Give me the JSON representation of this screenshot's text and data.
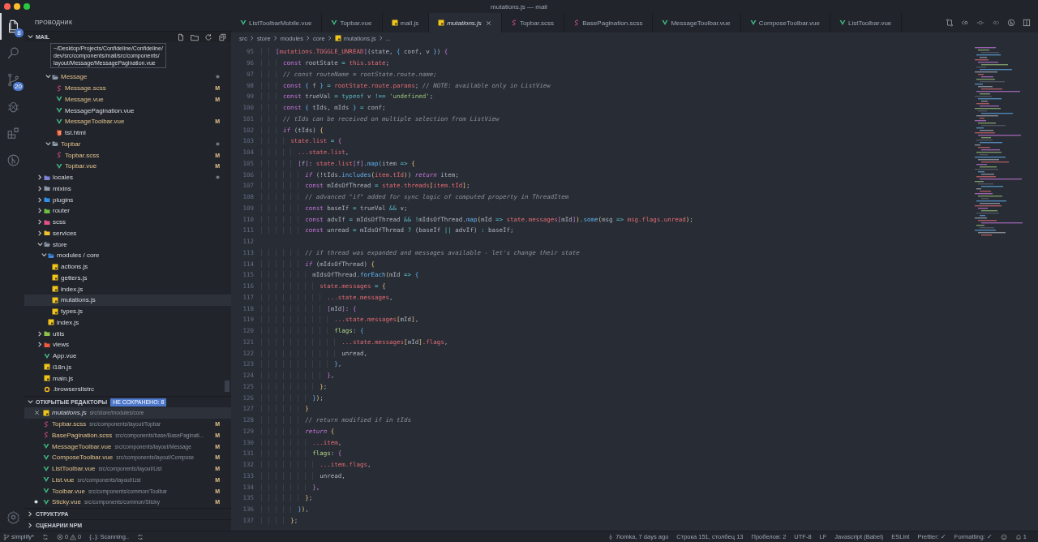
{
  "window": {
    "title": "mutations.js — mail"
  },
  "activity_bar": {
    "items": [
      {
        "kind": "files",
        "badge": "8",
        "selected": true
      },
      {
        "kind": "search",
        "selected": false
      },
      {
        "kind": "scm",
        "badge": "20",
        "selected": false
      },
      {
        "kind": "debug",
        "selected": false
      },
      {
        "kind": "extensions",
        "selected": false
      },
      {
        "kind": "gitlens",
        "selected": false
      }
    ],
    "bottom": [
      {
        "kind": "settings"
      }
    ]
  },
  "sidebar": {
    "title": "ПРОВОДНИК",
    "section": {
      "label": "MAIL",
      "expanded": true,
      "actions": [
        {
          "kind": "newfile"
        },
        {
          "kind": "newfolder"
        },
        {
          "kind": "refresh"
        },
        {
          "kind": "collapse"
        }
      ]
    },
    "tooltip": [
      "~/Desktop/Projects/Confideline/Confideline/",
      "dev/src/components/mail/src/components/",
      "layout/Message/MessagePagination.vue"
    ],
    "tree": [
      {
        "children": [
          {
            "children": [
              {
                "label": "Message",
                "kind": "folder",
                "color": "#8d99ab",
                "expanded": true,
                "dot": true,
                "modified": true,
                "selected": false,
                "children": [
                  {
                    "label": "Message.scss",
                    "kind": "scss",
                    "badge": "M",
                    "modified": true,
                    "selected": false
                  },
                  {
                    "label": "Message.vue",
                    "kind": "vue",
                    "badge": "M",
                    "modified": true,
                    "selected": false
                  },
                  {
                    "label": "MessagePagination.vue",
                    "kind": "vue",
                    "modified": false,
                    "selected": false
                  },
                  {
                    "label": "MessageToolbar.vue",
                    "kind": "vue",
                    "badge": "M",
                    "modified": true,
                    "selected": false
                  },
                  {
                    "label": "tst.html",
                    "kind": "html",
                    "modified": false,
                    "selected": false
                  }
                ]
              },
              {
                "label": "Topbar",
                "kind": "folder",
                "color": "#8d99ab",
                "expanded": true,
                "dot": true,
                "modified": true,
                "selected": false,
                "children": [
                  {
                    "label": "Topbar.scss",
                    "kind": "scss",
                    "badge": "M",
                    "modified": true,
                    "selected": false
                  },
                  {
                    "label": "Topbar.vue",
                    "kind": "vue",
                    "badge": "M",
                    "modified": true,
                    "selected": false
                  }
                ]
              }
            ]
          }
        ]
      },
      {
        "label": "locales",
        "kind": "folder",
        "color": "#7e83d8",
        "expanded": false,
        "dot": true,
        "modified": false,
        "selected": false
      },
      {
        "label": "mixins",
        "kind": "folder",
        "color": "#8d99ab",
        "expanded": false,
        "dot": false,
        "modified": false,
        "selected": false
      },
      {
        "label": "plugins",
        "kind": "folder",
        "color": "#2f8fea",
        "expanded": false,
        "dot": false,
        "modified": false,
        "selected": false
      },
      {
        "label": "router",
        "kind": "folder",
        "color": "#6cbf43",
        "expanded": false,
        "dot": false,
        "modified": false,
        "selected": false
      },
      {
        "label": "scss",
        "kind": "folder",
        "color": "#e8508e",
        "expanded": false,
        "dot": false,
        "modified": false,
        "selected": false
      },
      {
        "label": "services",
        "kind": "folder",
        "color": "#f2c12e",
        "expanded": false,
        "dot": false,
        "modified": false,
        "selected": false
      },
      {
        "label": "store",
        "kind": "folder",
        "color": "#8d99ab",
        "expanded": true,
        "dot": false,
        "modified": false,
        "selected": false,
        "children": [
          {
            "label": "modules / core",
            "kind": "folder",
            "color": "#3c8ae6",
            "expanded": true,
            "dot": false,
            "modified": false,
            "selected": false,
            "children": [
              {
                "label": "actions.js",
                "kind": "js",
                "modified": false,
                "selected": false
              },
              {
                "label": "getters.js",
                "kind": "js",
                "modified": false,
                "selected": false
              },
              {
                "label": "index.js",
                "kind": "js",
                "modified": false,
                "selected": false
              },
              {
                "label": "mutations.js",
                "kind": "js",
                "modified": false,
                "selected": true
              },
              {
                "label": "types.js",
                "kind": "js",
                "modified": false,
                "selected": false
              }
            ]
          },
          {
            "label": "index.js",
            "kind": "js",
            "modified": false,
            "selected": false
          }
        ]
      },
      {
        "label": "utils",
        "kind": "folder",
        "color": "#8bc34a",
        "expanded": false,
        "dot": false,
        "modified": false,
        "selected": false
      },
      {
        "label": "views",
        "kind": "folder",
        "color": "#ef5b3c",
        "expanded": false,
        "dot": false,
        "modified": false,
        "selected": false
      },
      {
        "label": "App.vue",
        "kind": "vue",
        "modified": false,
        "selected": false
      },
      {
        "label": "i18n.js",
        "kind": "js",
        "modified": false,
        "selected": false
      },
      {
        "label": "main.js",
        "kind": "js",
        "modified": false,
        "selected": false
      },
      {
        "label": ".browserslistrc",
        "kind": "rc",
        "modified": false,
        "selected": false
      }
    ],
    "open_editors": {
      "label": "ОТКРЫТЫЕ РЕДАКТОРЫ",
      "expanded": true,
      "unsaved": "НЕ СОХРАНЕНО: 8",
      "items": [
        {
          "name": "mutations.js",
          "path": "src/store/modules/core",
          "kind": "js",
          "selected": true,
          "preview": true,
          "dirty": false
        },
        {
          "name": "Topbar.scss",
          "path": "src/components/layout/Topbar",
          "kind": "scss",
          "badge": "M",
          "selected": false,
          "preview": false,
          "dirty": false
        },
        {
          "name": "BasePagination.scss",
          "path": "src/components/base/BasePaginati...",
          "kind": "scss",
          "badge": "M",
          "selected": false,
          "preview": false,
          "dirty": false
        },
        {
          "name": "MessageToolbar.vue",
          "path": "src/components/layout/Message",
          "kind": "vue",
          "badge": "M",
          "selected": false,
          "preview": false,
          "dirty": false
        },
        {
          "name": "ComposeToolbar.vue",
          "path": "src/components/layout/Compose",
          "kind": "vue",
          "badge": "M",
          "selected": false,
          "preview": false,
          "dirty": false
        },
        {
          "name": "ListToolbar.vue",
          "path": "src/components/layout/List",
          "kind": "vue",
          "badge": "M",
          "selected": false,
          "preview": false,
          "dirty": false
        },
        {
          "name": "List.vue",
          "path": "src/components/layout/List",
          "kind": "vue",
          "badge": "M",
          "selected": false,
          "preview": false,
          "dirty": false
        },
        {
          "name": "Toolbar.vue",
          "path": "src/components/common/Toolbar",
          "kind": "vue",
          "badge": "M",
          "selected": false,
          "preview": false,
          "dirty": false
        },
        {
          "name": "Sticky.vue",
          "path": "src/components/common/Sticky",
          "kind": "vue",
          "badge": "M",
          "selected": false,
          "preview": false,
          "dirty": true
        }
      ]
    },
    "collapsed_sections": [
      {
        "label": "СТРУКТУРА",
        "expanded": false
      },
      {
        "label": "СЦЕНАРИИ NPM",
        "expanded": false
      }
    ]
  },
  "tabs": [
    {
      "label": "ListToolbarMobile.vue",
      "kind": "vue",
      "selected": false,
      "preview": false
    },
    {
      "label": "Topbar.vue",
      "kind": "vue",
      "selected": false,
      "preview": false
    },
    {
      "label": "mail.js",
      "kind": "js",
      "selected": false,
      "preview": false
    },
    {
      "label": "mutations.js",
      "kind": "js",
      "selected": true,
      "preview": true
    },
    {
      "label": "Topbar.scss",
      "kind": "scss",
      "selected": false,
      "preview": false
    },
    {
      "label": "BasePagination.scss",
      "kind": "scss",
      "selected": false,
      "preview": false
    },
    {
      "label": "MessageToolbar.vue",
      "kind": "vue",
      "selected": false,
      "preview": false
    },
    {
      "label": "ComposeToolbar.vue",
      "kind": "vue",
      "selected": false,
      "preview": false
    },
    {
      "label": "ListToolbar.vue",
      "kind": "vue",
      "selected": false,
      "preview": false
    }
  ],
  "editor_actions": [
    {
      "kind": "compare"
    },
    {
      "kind": "back"
    },
    {
      "kind": "commit"
    },
    {
      "kind": "forward"
    },
    {
      "kind": "gitlens"
    },
    {
      "kind": "split"
    }
  ],
  "breadcrumb": [
    {
      "label": "src",
      "kind": "folder"
    },
    {
      "label": "store",
      "kind": "folder"
    },
    {
      "label": "modules",
      "kind": "folder"
    },
    {
      "label": "core",
      "kind": "folder"
    },
    {
      "label": "mutations.js",
      "kind": "js"
    },
    {
      "label": "...",
      "kind": "more"
    }
  ],
  "code": [
    {
      "num": "95",
      "tokens": [
        {
          "kind": "bm",
          "text": "    ["
        },
        {
          "kind": "var",
          "text": "mutations.TOGGLE_UNREAD"
        },
        {
          "kind": "bm",
          "text": "]"
        },
        {
          "kind": "pl",
          "text": "(state, "
        },
        {
          "kind": "bb",
          "text": "{"
        },
        {
          "kind": "pl",
          "text": " conf, v "
        },
        {
          "kind": "bb",
          "text": "}"
        },
        {
          "kind": "pl",
          "text": ") "
        },
        {
          "kind": "bm",
          "text": "{"
        }
      ]
    },
    {
      "num": "96",
      "tokens": [
        {
          "kind": "kw",
          "text": "      const"
        },
        {
          "kind": "pl",
          "text": " rootState "
        },
        {
          "kind": "op",
          "text": "= "
        },
        {
          "kind": "var",
          "text": "this.state"
        },
        {
          "kind": "pl",
          "text": ";"
        }
      ]
    },
    {
      "num": "97",
      "tokens": [
        {
          "kind": "com",
          "text": "      // const routeName = rootState.route.name;"
        }
      ]
    },
    {
      "num": "98",
      "tokens": [
        {
          "kind": "kw",
          "text": "      const"
        },
        {
          "kind": "bb",
          "text": " {"
        },
        {
          "kind": "pl",
          "text": " f "
        },
        {
          "kind": "bb",
          "text": "}"
        },
        {
          "kind": "op",
          "text": " = "
        },
        {
          "kind": "var",
          "text": "rootState.route.params"
        },
        {
          "kind": "pl",
          "text": "; "
        },
        {
          "kind": "com",
          "text": "// NOTE: available only in ListView"
        }
      ]
    },
    {
      "num": "99",
      "tokens": [
        {
          "kind": "kw",
          "text": "      const"
        },
        {
          "kind": "pl",
          "text": " trueVal "
        },
        {
          "kind": "op",
          "text": "= typeof "
        },
        {
          "kind": "pl",
          "text": "v "
        },
        {
          "kind": "op",
          "text": "!== "
        },
        {
          "kind": "str",
          "text": "'undefined'"
        },
        {
          "kind": "pl",
          "text": ";"
        }
      ]
    },
    {
      "num": "100",
      "tokens": [
        {
          "kind": "kw",
          "text": "      const"
        },
        {
          "kind": "bb",
          "text": " {"
        },
        {
          "kind": "pl",
          "text": " tIds, mIds "
        },
        {
          "kind": "bb",
          "text": "}"
        },
        {
          "kind": "op",
          "text": " = "
        },
        {
          "kind": "pl",
          "text": "conf;"
        }
      ]
    },
    {
      "num": "101",
      "tokens": [
        {
          "kind": "com",
          "text": "      // tIds can be received on multiple selection from ListView"
        }
      ]
    },
    {
      "num": "102",
      "tokens": [
        {
          "kind": "ctl",
          "text": "      if"
        },
        {
          "kind": "pl",
          "text": " (tIds) "
        },
        {
          "kind": "by",
          "text": "{"
        }
      ]
    },
    {
      "num": "103",
      "tokens": [
        {
          "kind": "var",
          "text": "        state.list"
        },
        {
          "kind": "op",
          "text": " = "
        },
        {
          "kind": "bm",
          "text": "{"
        }
      ]
    },
    {
      "num": "104",
      "tokens": [
        {
          "kind": "var",
          "text": "          ...state.list"
        },
        {
          "kind": "pl",
          "text": ","
        }
      ]
    },
    {
      "num": "105",
      "tokens": [
        {
          "kind": "bm",
          "text": "          ["
        },
        {
          "kind": "pl",
          "text": "f"
        },
        {
          "kind": "bm",
          "text": "]"
        },
        {
          "kind": "pl",
          "text": ": "
        },
        {
          "kind": "var",
          "text": "state.list"
        },
        {
          "kind": "bm",
          "text": "["
        },
        {
          "kind": "pl",
          "text": "f"
        },
        {
          "kind": "bm",
          "text": "]"
        },
        {
          "kind": "pl",
          "text": "."
        },
        {
          "kind": "fn",
          "text": "map"
        },
        {
          "kind": "bb",
          "text": "("
        },
        {
          "kind": "pl",
          "text": "item "
        },
        {
          "kind": "op",
          "text": "=> "
        },
        {
          "kind": "by",
          "text": "{"
        }
      ]
    },
    {
      "num": "106",
      "tokens": [
        {
          "kind": "ctl",
          "text": "            if"
        },
        {
          "kind": "pl",
          "text": " (!tIds."
        },
        {
          "kind": "fn",
          "text": "includes"
        },
        {
          "kind": "by",
          "text": "("
        },
        {
          "kind": "var",
          "text": "item.tId"
        },
        {
          "kind": "by",
          "text": ")"
        },
        {
          "kind": "pl",
          "text": ") "
        },
        {
          "kind": "ctl",
          "text": "return"
        },
        {
          "kind": "pl",
          "text": " item;"
        }
      ]
    },
    {
      "num": "107",
      "tokens": [
        {
          "kind": "kw",
          "text": "            const"
        },
        {
          "kind": "pl",
          "text": " mIdsOfThread "
        },
        {
          "kind": "op",
          "text": "= "
        },
        {
          "kind": "var",
          "text": "state.threads"
        },
        {
          "kind": "by",
          "text": "["
        },
        {
          "kind": "var",
          "text": "item.tId"
        },
        {
          "kind": "by",
          "text": "]"
        },
        {
          "kind": "pl",
          "text": ";"
        }
      ]
    },
    {
      "num": "108",
      "tokens": [
        {
          "kind": "com",
          "text": "            // advanced \"if\" added for sync logic of computed property in ThreadItem"
        }
      ]
    },
    {
      "num": "109",
      "tokens": [
        {
          "kind": "kw",
          "text": "            const"
        },
        {
          "kind": "pl",
          "text": " baseIf "
        },
        {
          "kind": "op",
          "text": "= "
        },
        {
          "kind": "pl",
          "text": "trueVal "
        },
        {
          "kind": "op",
          "text": "&& "
        },
        {
          "kind": "pl",
          "text": "v;"
        }
      ]
    },
    {
      "num": "110",
      "tokens": [
        {
          "kind": "kw",
          "text": "            const"
        },
        {
          "kind": "pl",
          "text": " advIf "
        },
        {
          "kind": "op",
          "text": "= "
        },
        {
          "kind": "pl",
          "text": "mIdsOfThread "
        },
        {
          "kind": "op",
          "text": "&& !"
        },
        {
          "kind": "pl",
          "text": "mIdsOfThread."
        },
        {
          "kind": "fn",
          "text": "map"
        },
        {
          "kind": "by",
          "text": "("
        },
        {
          "kind": "pl",
          "text": "mId "
        },
        {
          "kind": "op",
          "text": "=> "
        },
        {
          "kind": "var",
          "text": "state.messages"
        },
        {
          "kind": "bm",
          "text": "["
        },
        {
          "kind": "pl",
          "text": "mId"
        },
        {
          "kind": "bm",
          "text": "]"
        },
        {
          "kind": "by",
          "text": ")"
        },
        {
          "kind": "pl",
          "text": "."
        },
        {
          "kind": "fn",
          "text": "some"
        },
        {
          "kind": "by",
          "text": "("
        },
        {
          "kind": "pl",
          "text": "msg "
        },
        {
          "kind": "op",
          "text": "=> "
        },
        {
          "kind": "var",
          "text": "msg.flags.unread"
        },
        {
          "kind": "by",
          "text": ")"
        },
        {
          "kind": "pl",
          "text": ";"
        }
      ]
    },
    {
      "num": "111",
      "tokens": [
        {
          "kind": "kw",
          "text": "            const"
        },
        {
          "kind": "pl",
          "text": " unread "
        },
        {
          "kind": "op",
          "text": "= "
        },
        {
          "kind": "pl",
          "text": "mIdsOfThread "
        },
        {
          "kind": "op",
          "text": "? "
        },
        {
          "kind": "pl",
          "text": "(baseIf "
        },
        {
          "kind": "op",
          "text": "|| "
        },
        {
          "kind": "pl",
          "text": "advIf) "
        },
        {
          "kind": "op",
          "text": ": "
        },
        {
          "kind": "pl",
          "text": "baseIf;"
        }
      ]
    },
    {
      "num": "112"
    },
    {
      "num": "113",
      "tokens": [
        {
          "kind": "com",
          "text": "            // if thread was expanded and messages available - let's change their state"
        }
      ]
    },
    {
      "num": "114",
      "tokens": [
        {
          "kind": "ctl",
          "text": "            if"
        },
        {
          "kind": "pl",
          "text": " (mIdsOfThread) "
        },
        {
          "kind": "by",
          "text": "{"
        }
      ]
    },
    {
      "num": "115",
      "tokens": [
        {
          "kind": "pl",
          "text": "              mIdsOfThread."
        },
        {
          "kind": "fn",
          "text": "forEach"
        },
        {
          "kind": "by",
          "text": "("
        },
        {
          "kind": "pl",
          "text": "mId "
        },
        {
          "kind": "op",
          "text": "=> "
        },
        {
          "kind": "bb",
          "text": "{"
        }
      ]
    },
    {
      "num": "116",
      "tokens": [
        {
          "kind": "var",
          "text": "                state.messages"
        },
        {
          "kind": "op",
          "text": " = "
        },
        {
          "kind": "by",
          "text": "{"
        }
      ]
    },
    {
      "num": "117",
      "tokens": [
        {
          "kind": "var",
          "text": "                  ...state.messages"
        },
        {
          "kind": "pl",
          "text": ","
        }
      ]
    },
    {
      "num": "118",
      "tokens": [
        {
          "kind": "bm",
          "text": "                  ["
        },
        {
          "kind": "pl",
          "text": "mId"
        },
        {
          "kind": "bm",
          "text": "]"
        },
        {
          "kind": "pl",
          "text": ": "
        },
        {
          "kind": "bm",
          "text": "{"
        }
      ]
    },
    {
      "num": "119",
      "tokens": [
        {
          "kind": "var",
          "text": "                    ...state.messages"
        },
        {
          "kind": "by",
          "text": "["
        },
        {
          "kind": "pl",
          "text": "mId"
        },
        {
          "kind": "by",
          "text": "]"
        },
        {
          "kind": "pl",
          "text": ","
        }
      ]
    },
    {
      "num": "120",
      "tokens": [
        {
          "kind": "key",
          "text": "                    flags"
        },
        {
          "kind": "pl",
          "text": ": "
        },
        {
          "kind": "bb",
          "text": "{"
        }
      ]
    },
    {
      "num": "121",
      "tokens": [
        {
          "kind": "var",
          "text": "                      ...state.messages"
        },
        {
          "kind": "by",
          "text": "["
        },
        {
          "kind": "pl",
          "text": "mId"
        },
        {
          "kind": "by",
          "text": "]"
        },
        {
          "kind": "var",
          "text": ".flags"
        },
        {
          "kind": "pl",
          "text": ","
        }
      ]
    },
    {
      "num": "122",
      "tokens": [
        {
          "kind": "pl",
          "text": "                      unread,"
        }
      ]
    },
    {
      "num": "123",
      "tokens": [
        {
          "kind": "bb",
          "text": "                    }"
        },
        {
          "kind": "pl",
          "text": ","
        }
      ]
    },
    {
      "num": "124",
      "tokens": [
        {
          "kind": "bm",
          "text": "                  }"
        },
        {
          "kind": "pl",
          "text": ","
        }
      ]
    },
    {
      "num": "125",
      "tokens": [
        {
          "kind": "by",
          "text": "                }"
        },
        {
          "kind": "pl",
          "text": ";"
        }
      ]
    },
    {
      "num": "126",
      "tokens": [
        {
          "kind": "bb",
          "text": "              }"
        },
        {
          "kind": "by",
          "text": ")"
        },
        {
          "kind": "pl",
          "text": ";"
        }
      ]
    },
    {
      "num": "127",
      "tokens": [
        {
          "kind": "by",
          "text": "            }"
        }
      ]
    },
    {
      "num": "128",
      "tokens": [
        {
          "kind": "com",
          "text": "            // return modified if in tIds"
        }
      ]
    },
    {
      "num": "129",
      "tokens": [
        {
          "kind": "ctl",
          "text": "            return"
        },
        {
          "kind": "by",
          "text": " {"
        }
      ]
    },
    {
      "num": "130",
      "tokens": [
        {
          "kind": "var",
          "text": "              ...item"
        },
        {
          "kind": "pl",
          "text": ","
        }
      ]
    },
    {
      "num": "131",
      "tokens": [
        {
          "kind": "key",
          "text": "              flags"
        },
        {
          "kind": "pl",
          "text": ": "
        },
        {
          "kind": "bm",
          "text": "{"
        }
      ]
    },
    {
      "num": "132",
      "tokens": [
        {
          "kind": "var",
          "text": "                ...item.flags"
        },
        {
          "kind": "pl",
          "text": ","
        }
      ]
    },
    {
      "num": "133",
      "tokens": [
        {
          "kind": "pl",
          "text": "                unread,"
        }
      ]
    },
    {
      "num": "134",
      "tokens": [
        {
          "kind": "bm",
          "text": "              }"
        },
        {
          "kind": "pl",
          "text": ","
        }
      ]
    },
    {
      "num": "135",
      "tokens": [
        {
          "kind": "by",
          "text": "            }"
        },
        {
          "kind": "pl",
          "text": ";"
        }
      ]
    },
    {
      "num": "136",
      "tokens": [
        {
          "kind": "bb",
          "text": "          }"
        },
        {
          "kind": "by",
          "text": ")"
        },
        {
          "kind": "pl",
          "text": ","
        }
      ]
    },
    {
      "num": "137",
      "tokens": [
        {
          "kind": "by",
          "text": "        }"
        },
        {
          "kind": "pl",
          "text": ";"
        }
      ]
    }
  ],
  "status_bar": {
    "left": [
      {
        "kind": "branch",
        "text": "simplify*"
      },
      {
        "kind": "sync"
      },
      {
        "kind": "problems",
        "errors": "0",
        "warnings": "0"
      },
      {
        "kind": "text",
        "text": "{..}: Scanning.."
      },
      {
        "kind": "sync"
      }
    ],
    "right": [
      {
        "kind": "commit",
        "text": "7iomka, 7 days ago"
      },
      {
        "kind": "text",
        "text": "Строка 151, столбец 13"
      },
      {
        "kind": "text",
        "text": "Пробелов: 2"
      },
      {
        "kind": "text",
        "text": "UTF-8"
      },
      {
        "kind": "text",
        "text": "LF"
      },
      {
        "kind": "text",
        "text": "Javascript (Babel)"
      },
      {
        "kind": "text",
        "text": "ESLint"
      },
      {
        "kind": "text",
        "text": "Prettier: ✓"
      },
      {
        "kind": "text",
        "text": "Formatting: ✓"
      },
      {
        "kind": "smiley"
      },
      {
        "kind": "bell",
        "text": "1"
      }
    ]
  }
}
